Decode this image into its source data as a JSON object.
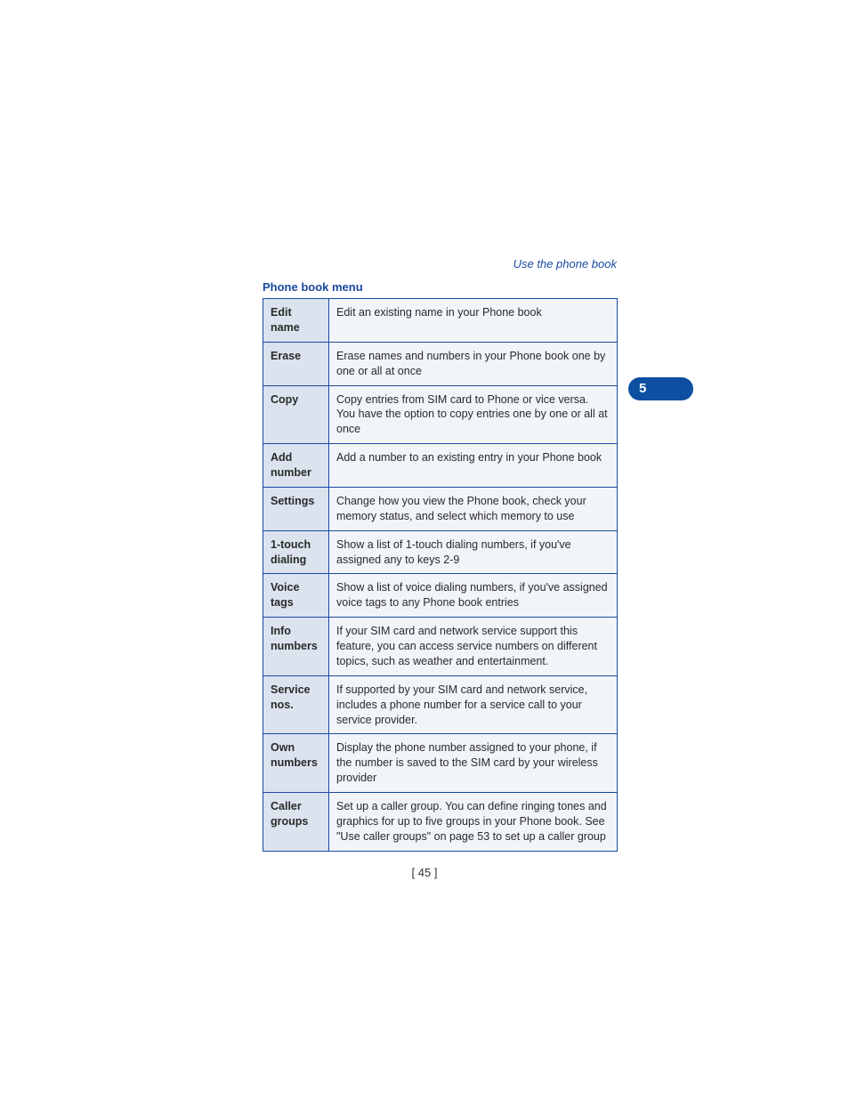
{
  "header": {
    "link": "Use the phone book"
  },
  "section": {
    "title": "Phone book menu"
  },
  "tab": {
    "number": "5"
  },
  "menu": {
    "rows": [
      {
        "name": "Edit name",
        "desc": "Edit an existing name in your Phone book"
      },
      {
        "name": "Erase",
        "desc": "Erase names and numbers in your Phone book one by one or all at once"
      },
      {
        "name": "Copy",
        "desc": "Copy entries from SIM card to Phone or vice versa. You have the option to copy entries one by one or all at once"
      },
      {
        "name": "Add number",
        "desc": "Add a number to an existing entry in your Phone book"
      },
      {
        "name": "Settings",
        "desc": "Change how you view the Phone book, check your memory status, and select which memory to use"
      },
      {
        "name": "1-touch dialing",
        "desc": "Show a list of 1-touch dialing numbers, if you've assigned any to keys 2-9"
      },
      {
        "name": "Voice tags",
        "desc": "Show a list of voice dialing numbers, if you've assigned voice tags to any Phone book entries"
      },
      {
        "name": "Info numbers",
        "desc": "If your SIM card and network service support this feature, you can access service numbers on different topics, such as weather and entertainment."
      },
      {
        "name": "Service nos.",
        "desc": "If supported by your SIM card and network service, includes a phone number for a service call to your service provider."
      },
      {
        "name": "Own numbers",
        "desc": "Display the phone number assigned to your phone, if the number is saved to the SIM card by your wireless provider"
      },
      {
        "name": "Caller groups",
        "desc": "Set up a caller group. You can define ringing tones and graphics for up to five groups in your Phone book. See \"Use caller groups\" on page 53 to set up a caller group"
      }
    ]
  },
  "footer": {
    "page_number": "[ 45 ]"
  }
}
